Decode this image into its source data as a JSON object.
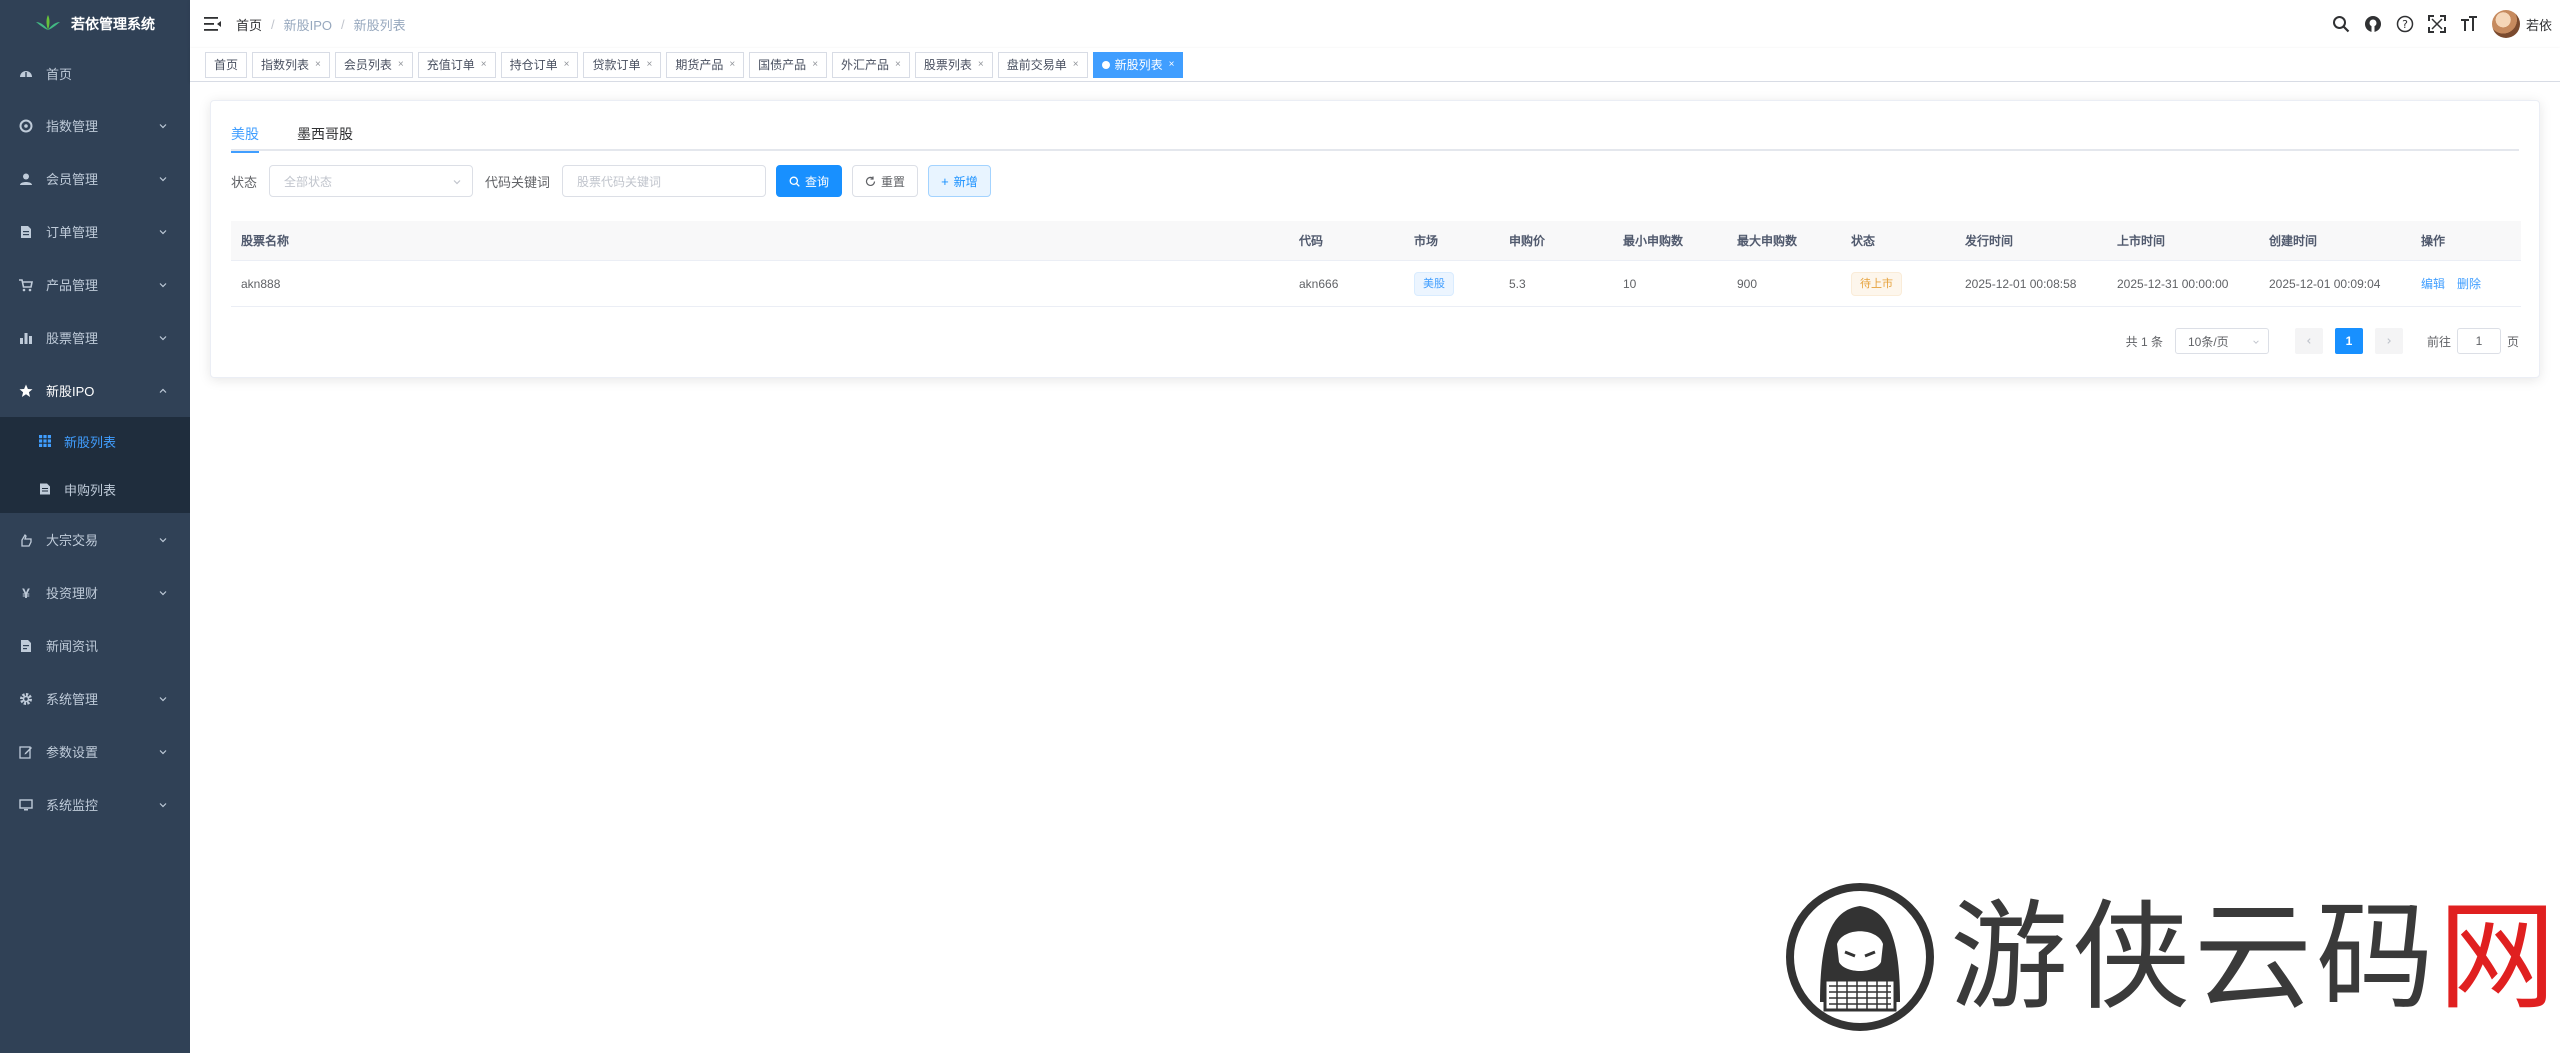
{
  "app": {
    "title": "若依管理系统"
  },
  "sidebar": {
    "items": [
      {
        "label": "首页",
        "icon": "dashboard-icon"
      },
      {
        "label": "指数管理",
        "icon": "target-icon"
      },
      {
        "label": "会员管理",
        "icon": "user-icon"
      },
      {
        "label": "订单管理",
        "icon": "document-icon"
      },
      {
        "label": "产品管理",
        "icon": "cart-icon"
      },
      {
        "label": "股票管理",
        "icon": "chart-icon"
      },
      {
        "label": "新股IPO",
        "icon": "star-icon"
      },
      {
        "label": "大宗交易",
        "icon": "hand-icon"
      },
      {
        "label": "投资理财",
        "icon": "yen-icon"
      },
      {
        "label": "新闻资讯",
        "icon": "news-icon"
      },
      {
        "label": "系统管理",
        "icon": "gear-icon"
      },
      {
        "label": "参数设置",
        "icon": "edit-icon"
      },
      {
        "label": "系统监控",
        "icon": "monitor-icon"
      }
    ],
    "sub_items": [
      {
        "label": "新股列表",
        "icon": "grid-icon"
      },
      {
        "label": "申购列表",
        "icon": "list-icon"
      }
    ]
  },
  "navbar": {
    "breadcrumb": [
      "首页",
      "新股IPO",
      "新股列表"
    ],
    "user_name": "若依"
  },
  "tags": [
    {
      "label": "首页",
      "closable": false
    },
    {
      "label": "指数列表",
      "closable": true
    },
    {
      "label": "会员列表",
      "closable": true
    },
    {
      "label": "充值订单",
      "closable": true
    },
    {
      "label": "持仓订单",
      "closable": true
    },
    {
      "label": "贷款订单",
      "closable": true
    },
    {
      "label": "期货产品",
      "closable": true
    },
    {
      "label": "国债产品",
      "closable": true
    },
    {
      "label": "外汇产品",
      "closable": true
    },
    {
      "label": "股票列表",
      "closable": true
    },
    {
      "label": "盘前交易单",
      "closable": true
    },
    {
      "label": "新股列表",
      "closable": true,
      "active": true
    }
  ],
  "tabs": [
    "美股",
    "墨西哥股"
  ],
  "filter": {
    "status_label": "状态",
    "status_placeholder": "全部状态",
    "keyword_label": "代码关键词",
    "keyword_placeholder": "股票代码关键词",
    "search_btn": "查询",
    "reset_btn": "重置",
    "add_btn": "新增"
  },
  "table": {
    "headers": [
      "股票名称",
      "代码",
      "市场",
      "申购价",
      "最小申购数",
      "最大申购数",
      "状态",
      "发行时间",
      "上市时间",
      "创建时间",
      "操作"
    ],
    "rows": [
      {
        "name": "akn888",
        "code": "akn666",
        "market": "美股",
        "price": "5.3",
        "min_qty": "10",
        "max_qty": "900",
        "status": "待上市",
        "issue_time": "2025-12-01 00:08:58",
        "list_time": "2025-12-31 00:00:00",
        "create_time": "2025-12-01 00:09:04",
        "edit": "编辑",
        "delete": "删除"
      }
    ]
  },
  "pagination": {
    "total": "共 1 条",
    "page_size": "10条/页",
    "current": "1",
    "goto_prefix": "前往",
    "goto_value": "1",
    "goto_suffix": "页"
  },
  "watermark": {
    "text_main": "游侠云码",
    "text_red": "网"
  },
  "colors": {
    "sidebar_bg": "#304156",
    "primary": "#1890ff",
    "active_tag": "#409eff",
    "warning": "#e6a23c"
  }
}
